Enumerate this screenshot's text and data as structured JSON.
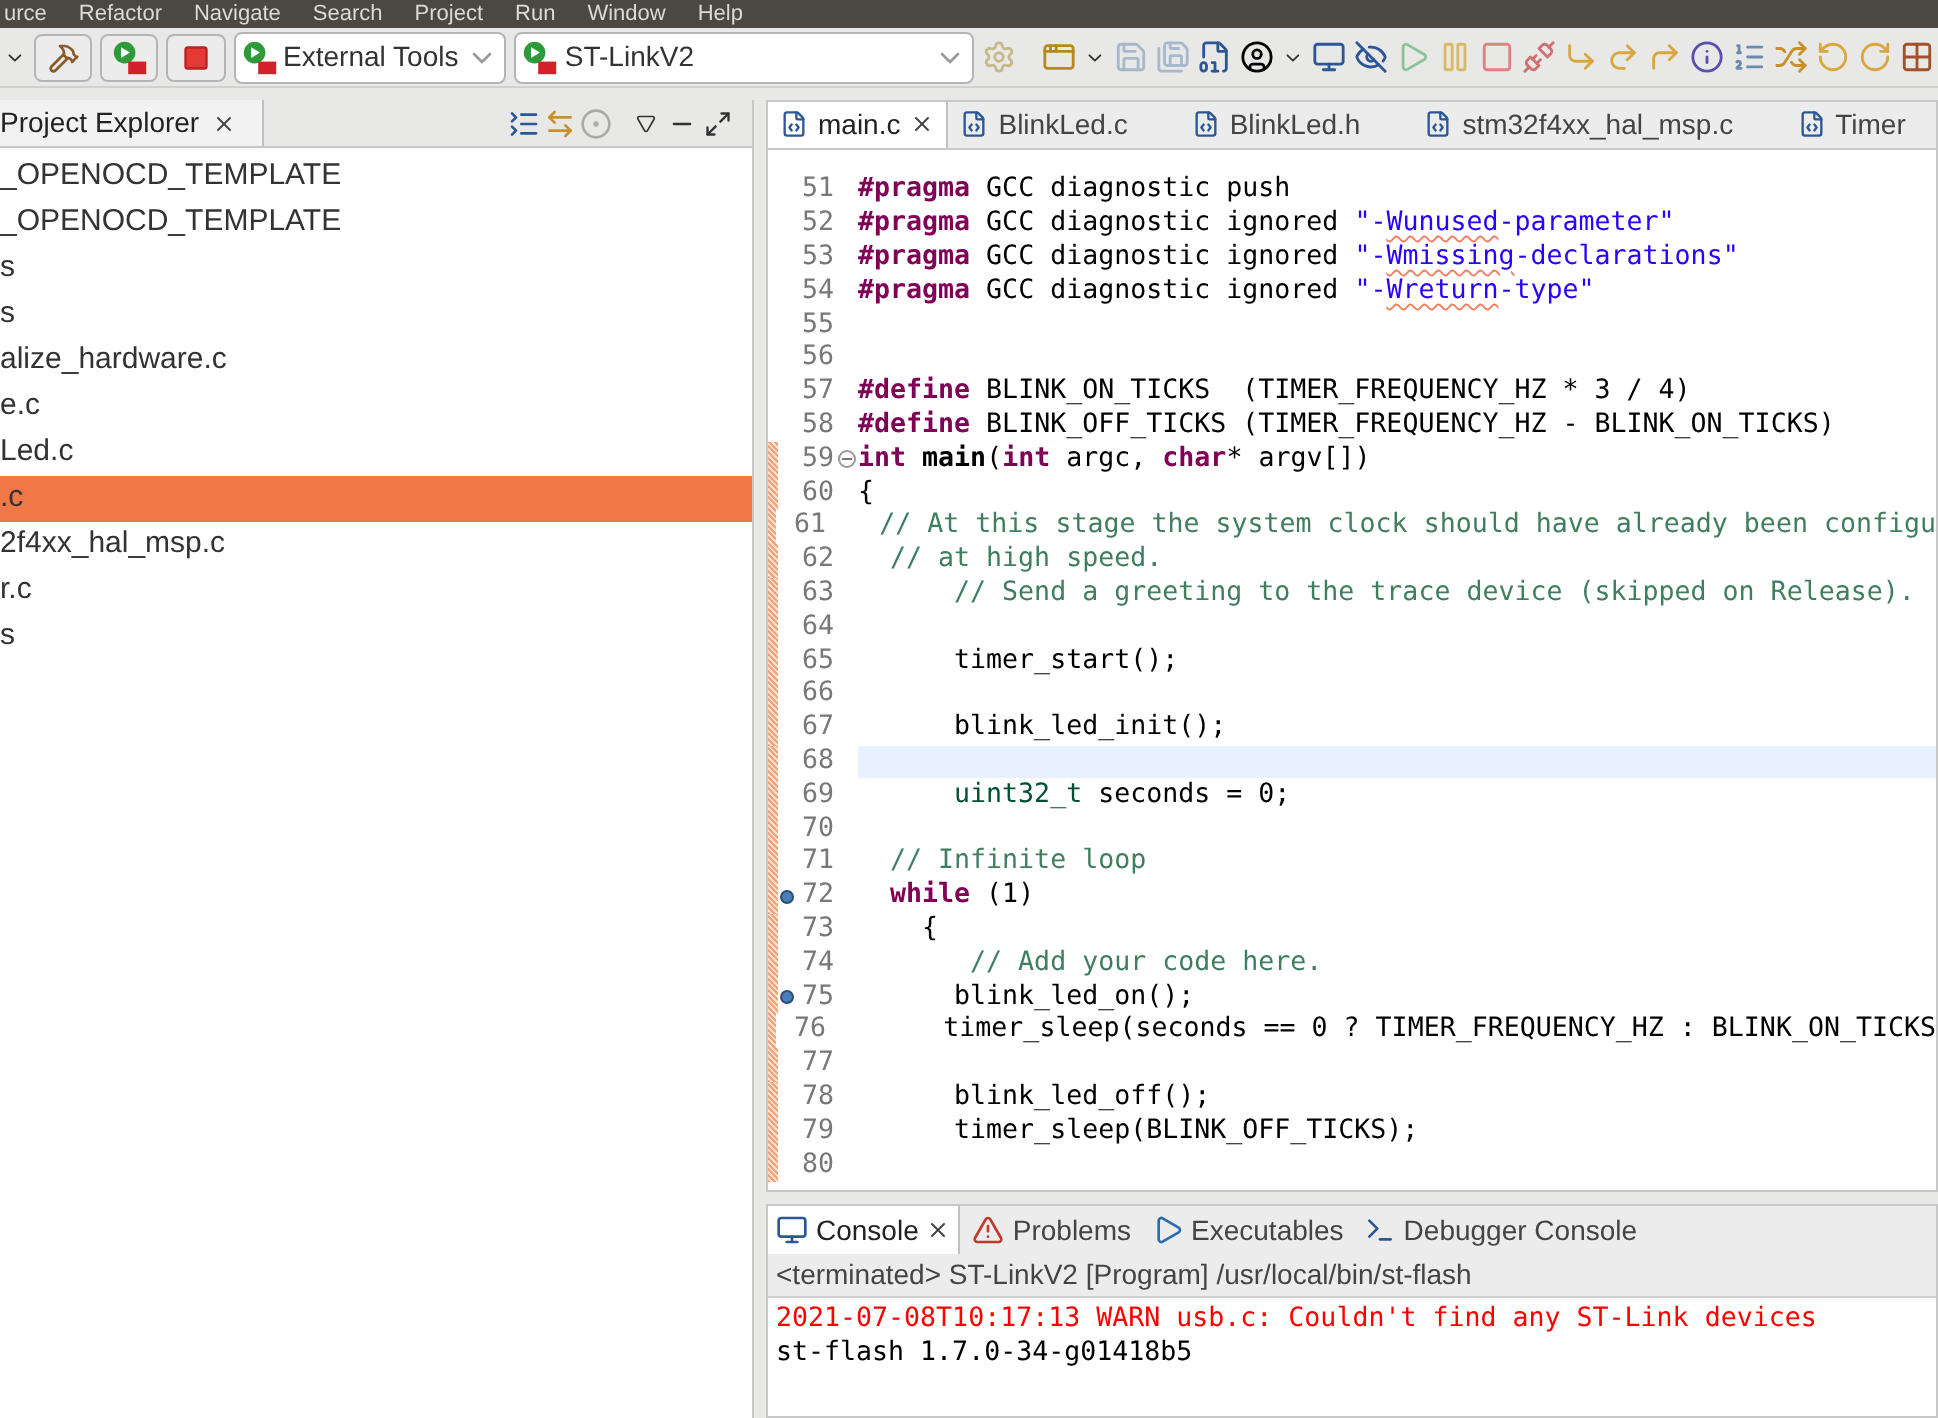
{
  "menu_bar": {
    "items": [
      "urce",
      "Refactor",
      "Navigate",
      "Search",
      "Project",
      "Run",
      "Window",
      "Help"
    ]
  },
  "toolbar": {
    "launch_mode": {
      "label": "External Tools"
    },
    "launch_config": {
      "label": "ST-LinkV2"
    }
  },
  "project_explorer": {
    "title": "Project Explorer",
    "items": [
      {
        "label": "_OPENOCD_TEMPLATE",
        "selected": false
      },
      {
        "label": "_OPENOCD_TEMPLATE",
        "selected": false
      },
      {
        "label": "s",
        "selected": false
      },
      {
        "label": "s",
        "selected": false
      },
      {
        "label": "alize_hardware.c",
        "selected": false
      },
      {
        "label": "e.c",
        "selected": false
      },
      {
        "label": "Led.c",
        "selected": false
      },
      {
        "label": ".c",
        "selected": true
      },
      {
        "label": "2f4xx_hal_msp.c",
        "selected": false
      },
      {
        "label": "r.c",
        "selected": false
      },
      {
        "label": "s",
        "selected": false
      }
    ]
  },
  "editor": {
    "tabs": [
      {
        "label": "main.c",
        "selected": true
      },
      {
        "label": "BlinkLed.c",
        "selected": false
      },
      {
        "label": "BlinkLed.h",
        "selected": false
      },
      {
        "label": "stm32f4xx_hal_msp.c",
        "selected": false
      },
      {
        "label": "Timer",
        "selected": false
      }
    ],
    "lines": [
      {
        "number": "51",
        "changed": false,
        "current": false,
        "breakpoint": false,
        "fold": false,
        "tokens": [
          {
            "kind": "keyword",
            "text": "#pragma"
          },
          {
            "kind": "plain",
            "text": " GCC diagnostic push"
          }
        ]
      },
      {
        "number": "52",
        "changed": false,
        "current": false,
        "breakpoint": false,
        "fold": false,
        "tokens": [
          {
            "kind": "keyword",
            "text": "#pragma"
          },
          {
            "kind": "plain",
            "text": " GCC diagnostic ignored "
          },
          {
            "kind": "string",
            "text": "\"-"
          },
          {
            "kind": "string",
            "text": "Wunused",
            "squiggle": true
          },
          {
            "kind": "string",
            "text": "-parameter\""
          }
        ]
      },
      {
        "number": "53",
        "changed": false,
        "current": false,
        "breakpoint": false,
        "fold": false,
        "tokens": [
          {
            "kind": "keyword",
            "text": "#pragma"
          },
          {
            "kind": "plain",
            "text": " GCC diagnostic ignored "
          },
          {
            "kind": "string",
            "text": "\"-"
          },
          {
            "kind": "string",
            "text": "Wmissing",
            "squiggle": true
          },
          {
            "kind": "string",
            "text": "-declarations\""
          }
        ]
      },
      {
        "number": "54",
        "changed": false,
        "current": false,
        "breakpoint": false,
        "fold": false,
        "tokens": [
          {
            "kind": "keyword",
            "text": "#pragma"
          },
          {
            "kind": "plain",
            "text": " GCC diagnostic ignored "
          },
          {
            "kind": "string",
            "text": "\"-"
          },
          {
            "kind": "string",
            "text": "Wreturn",
            "squiggle": true
          },
          {
            "kind": "string",
            "text": "-type\""
          }
        ]
      },
      {
        "number": "55",
        "changed": false,
        "current": false,
        "breakpoint": false,
        "fold": false
      },
      {
        "number": "56",
        "changed": false,
        "current": false,
        "breakpoint": false,
        "fold": false
      },
      {
        "number": "57",
        "changed": false,
        "current": false,
        "breakpoint": false,
        "fold": false,
        "tokens": [
          {
            "kind": "keyword",
            "text": "#define"
          },
          {
            "kind": "plain",
            "text": " BLINK_ON_TICKS  (TIMER_FREQUENCY_HZ * 3 / 4)"
          }
        ]
      },
      {
        "number": "58",
        "changed": false,
        "current": false,
        "breakpoint": false,
        "fold": false,
        "tokens": [
          {
            "kind": "keyword",
            "text": "#define"
          },
          {
            "kind": "plain",
            "text": " BLINK_OFF_TICKS (TIMER_FREQUENCY_HZ - BLINK_ON_TICKS)"
          }
        ]
      },
      {
        "number": "59",
        "changed": true,
        "current": false,
        "breakpoint": false,
        "fold": true,
        "tokens": [
          {
            "kind": "keyword",
            "text": "int"
          },
          {
            "kind": "function",
            "text": " main"
          },
          {
            "kind": "plain",
            "text": "("
          },
          {
            "kind": "keyword",
            "text": "int"
          },
          {
            "kind": "plain",
            "text": " argc, "
          },
          {
            "kind": "keyword",
            "text": "char"
          },
          {
            "kind": "plain",
            "text": "* argv[])"
          }
        ]
      },
      {
        "number": "60",
        "changed": true,
        "current": false,
        "breakpoint": false,
        "fold": false,
        "tokens": [
          {
            "kind": "plain",
            "text": "{"
          }
        ]
      },
      {
        "number": "61",
        "changed": true,
        "current": false,
        "breakpoint": false,
        "fold": false,
        "tokens": [
          {
            "kind": "comment",
            "text": "  // At this stage the system clock should have already been configu"
          }
        ]
      },
      {
        "number": "62",
        "changed": true,
        "current": false,
        "breakpoint": false,
        "fold": false,
        "tokens": [
          {
            "kind": "comment",
            "text": "  // at high speed."
          }
        ]
      },
      {
        "number": "63",
        "changed": true,
        "current": false,
        "breakpoint": false,
        "fold": false,
        "tokens": [
          {
            "kind": "comment",
            "text": "      // Send a greeting to the trace device (skipped on Release)."
          }
        ]
      },
      {
        "number": "64",
        "changed": true,
        "current": false,
        "breakpoint": false,
        "fold": false
      },
      {
        "number": "65",
        "changed": true,
        "current": false,
        "breakpoint": false,
        "fold": false,
        "tokens": [
          {
            "kind": "plain",
            "text": "      timer_start();"
          }
        ]
      },
      {
        "number": "66",
        "changed": true,
        "current": false,
        "breakpoint": false,
        "fold": false
      },
      {
        "number": "67",
        "changed": true,
        "current": false,
        "breakpoint": false,
        "fold": false,
        "tokens": [
          {
            "kind": "plain",
            "text": "      blink_led_init();"
          }
        ]
      },
      {
        "number": "68",
        "changed": true,
        "current": true,
        "breakpoint": false,
        "fold": false
      },
      {
        "number": "69",
        "changed": true,
        "current": false,
        "breakpoint": false,
        "fold": false,
        "tokens": [
          {
            "kind": "type",
            "text": "      uint32_t"
          },
          {
            "kind": "plain",
            "text": " seconds = 0;"
          }
        ]
      },
      {
        "number": "70",
        "changed": true,
        "current": false,
        "breakpoint": false,
        "fold": false
      },
      {
        "number": "71",
        "changed": true,
        "current": false,
        "breakpoint": false,
        "fold": false,
        "tokens": [
          {
            "kind": "comment",
            "text": "  // Infinite loop"
          }
        ]
      },
      {
        "number": "72",
        "changed": true,
        "current": false,
        "breakpoint": true,
        "fold": false,
        "tokens": [
          {
            "kind": "keyword",
            "text": "  while"
          },
          {
            "kind": "plain",
            "text": " (1)"
          }
        ]
      },
      {
        "number": "73",
        "changed": true,
        "current": false,
        "breakpoint": false,
        "fold": false,
        "tokens": [
          {
            "kind": "plain",
            "text": "    {"
          }
        ]
      },
      {
        "number": "74",
        "changed": true,
        "current": false,
        "breakpoint": false,
        "fold": false,
        "tokens": [
          {
            "kind": "comment",
            "text": "       // Add your code here."
          }
        ]
      },
      {
        "number": "75",
        "changed": true,
        "current": false,
        "breakpoint": true,
        "fold": false,
        "tokens": [
          {
            "kind": "plain",
            "text": "      blink_led_on();"
          }
        ]
      },
      {
        "number": "76",
        "changed": true,
        "current": false,
        "breakpoint": false,
        "fold": false,
        "tokens": [
          {
            "kind": "plain",
            "text": "      timer_sleep(seconds == 0 ? TIMER_FREQUENCY_HZ : BLINK_ON_TICKS"
          }
        ]
      },
      {
        "number": "77",
        "changed": true,
        "current": false,
        "breakpoint": false,
        "fold": false
      },
      {
        "number": "78",
        "changed": true,
        "current": false,
        "breakpoint": false,
        "fold": false,
        "tokens": [
          {
            "kind": "plain",
            "text": "      blink_led_off();"
          }
        ]
      },
      {
        "number": "79",
        "changed": true,
        "current": false,
        "breakpoint": false,
        "fold": false,
        "tokens": [
          {
            "kind": "plain",
            "text": "      timer_sleep(BLINK_OFF_TICKS);"
          }
        ]
      },
      {
        "number": "80",
        "changed": true,
        "current": false,
        "breakpoint": false,
        "fold": false
      }
    ]
  },
  "console": {
    "tabs": [
      {
        "label": "Console",
        "selected": true,
        "kind": "console"
      },
      {
        "label": "Problems",
        "selected": false,
        "kind": "problems"
      },
      {
        "label": "Executables",
        "selected": false,
        "kind": "executables"
      },
      {
        "label": "Debugger Console",
        "selected": false,
        "kind": "debugger"
      }
    ],
    "header": "<terminated> ST-LinkV2 [Program] /usr/local/bin/st-flash",
    "output": [
      {
        "kind": "error",
        "text": "2021-07-08T10:17:13 WARN usb.c: Couldn't find any ST-Link devices"
      },
      {
        "kind": "normal",
        "text": "st-flash 1.7.0-34-g01418b5"
      }
    ]
  }
}
